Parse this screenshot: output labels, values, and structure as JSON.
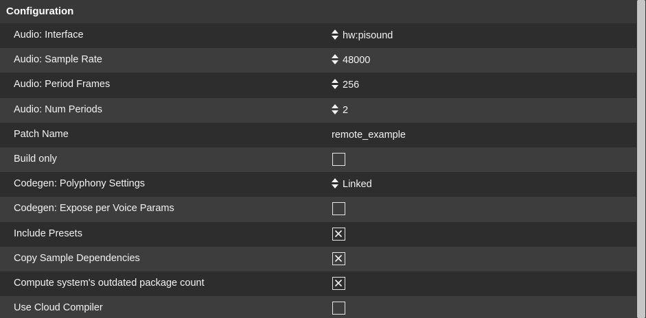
{
  "panel": {
    "title": "Configuration"
  },
  "rows": [
    {
      "label": "Audio: Interface",
      "type": "spin",
      "value": "hw:pisound"
    },
    {
      "label": "Audio: Sample Rate",
      "type": "spin",
      "value": "48000"
    },
    {
      "label": "Audio: Period Frames",
      "type": "spin",
      "value": "256"
    },
    {
      "label": "Audio: Num Periods",
      "type": "spin",
      "value": "2"
    },
    {
      "label": "Patch Name",
      "type": "text",
      "value": "remote_example"
    },
    {
      "label": "Build only",
      "type": "checkbox",
      "checked": false
    },
    {
      "label": "Codegen: Polyphony Settings",
      "type": "spin",
      "value": "Linked"
    },
    {
      "label": "Codegen: Expose per Voice Params",
      "type": "checkbox",
      "checked": false
    },
    {
      "label": "Include Presets",
      "type": "checkbox",
      "checked": true
    },
    {
      "label": "Copy Sample Dependencies",
      "type": "checkbox",
      "checked": true
    },
    {
      "label": "Compute system's outdated package count",
      "type": "checkbox",
      "checked": true
    },
    {
      "label": "Use Cloud Compiler",
      "type": "checkbox",
      "checked": false
    }
  ],
  "icons": {
    "spin": "updown-arrows-icon",
    "check": "x-mark-icon"
  },
  "colors": {
    "row_dark": "#2d2d2d",
    "row_light": "#3d3d3d",
    "header": "#383838",
    "scrollbar_thumb": "#c6c6c6",
    "text": "#f2f2f2"
  }
}
